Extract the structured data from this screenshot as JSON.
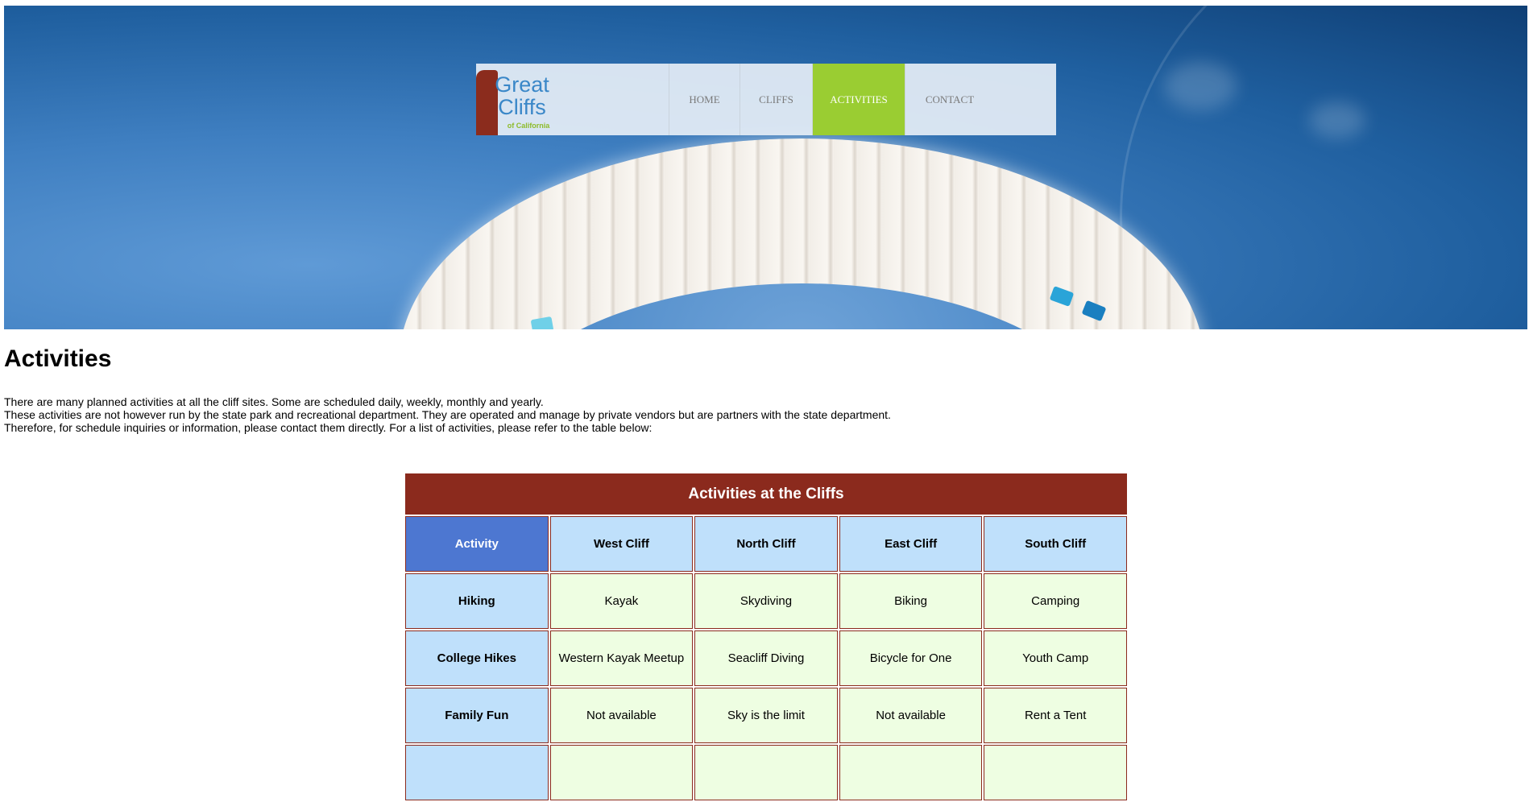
{
  "nav": {
    "logo": {
      "line1": "Great",
      "line2": "Cliffs",
      "tagline": "of California"
    },
    "items": [
      {
        "label": "HOME",
        "active": false
      },
      {
        "label": "CLIFFS",
        "active": false
      },
      {
        "label": "ACTIVITIES",
        "active": true
      },
      {
        "label": "CONTACT",
        "active": false
      }
    ],
    "active_color": "#9acd32"
  },
  "page": {
    "title": "Activities",
    "intro": [
      "There are many planned activities at all the cliff sites. Some are scheduled daily, weekly, monthly and yearly.",
      "These activities are not however run by the state park and recreational department. They are operated and manage by private vendors but are partners with the state department.",
      "Therefore, for schedule inquiries or information, please contact them directly. For a list of activities, please refer to the table below:"
    ]
  },
  "table": {
    "caption": "Activities at the Cliffs",
    "headers": [
      "Activity",
      "West Cliff",
      "North Cliff",
      "East Cliff",
      "South Cliff"
    ],
    "rows": [
      {
        "activity": "Hiking",
        "cells": [
          "Kayak",
          "Skydiving",
          "Biking",
          "Camping"
        ]
      },
      {
        "activity": "College Hikes",
        "cells": [
          "Western Kayak Meetup",
          "Seacliff Diving",
          "Bicycle for One",
          "Youth Camp"
        ]
      },
      {
        "activity": "Family Fun",
        "cells": [
          "Not available",
          "Sky is the limit",
          "Not available",
          "Rent a Tent"
        ]
      },
      {
        "activity": "",
        "cells": [
          "",
          "",
          "",
          ""
        ]
      }
    ],
    "colors": {
      "caption": "#8b2a1d",
      "corner": "#4d77d1",
      "header": "#bfe0fb",
      "cell": "#eefee2"
    }
  }
}
